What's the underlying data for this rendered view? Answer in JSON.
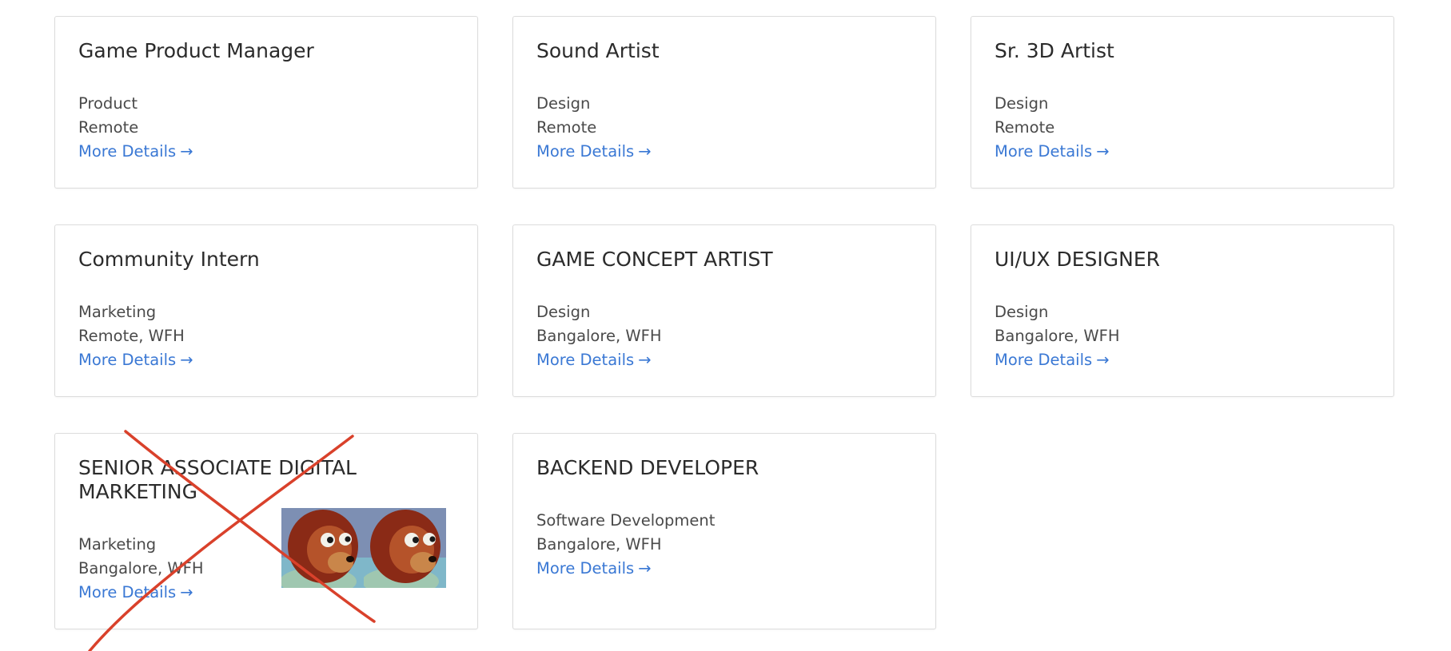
{
  "jobs": [
    {
      "title": "Game Product Manager",
      "department": "Product",
      "location": "Remote",
      "link_label": "More Details",
      "link_arrow": "→"
    },
    {
      "title": "Sound Artist",
      "department": "Design",
      "location": "Remote",
      "link_label": "More Details",
      "link_arrow": "→"
    },
    {
      "title": "Sr. 3D Artist",
      "department": "Design",
      "location": "Remote",
      "link_label": "More Details",
      "link_arrow": "→"
    },
    {
      "title": "Community Intern",
      "department": "Marketing",
      "location": "Remote, WFH",
      "link_label": "More Details",
      "link_arrow": "→"
    },
    {
      "title": "GAME CONCEPT ARTIST",
      "department": "Design",
      "location": "Bangalore, WFH",
      "link_label": "More Details",
      "link_arrow": "→"
    },
    {
      "title": "UI/UX DESIGNER",
      "department": "Design",
      "location": "Bangalore, WFH",
      "link_label": "More Details",
      "link_arrow": "→"
    },
    {
      "title": "SENIOR ASSOCIATE DIGITAL MARKETING",
      "department": "Marketing",
      "location": "Bangalore, WFH",
      "link_label": "More Details",
      "link_arrow": "→"
    },
    {
      "title": "BACKEND DEVELOPER",
      "department": "Software Development",
      "location": "Bangalore, WFH",
      "link_label": "More Details",
      "link_arrow": "→"
    }
  ],
  "colors": {
    "link": "#3a78d4",
    "border": "#dcdcdc",
    "cross_mark": "#d9412b"
  }
}
